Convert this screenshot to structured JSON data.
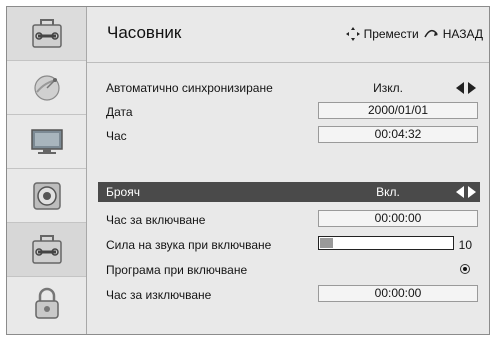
{
  "header": {
    "title": "Часовник",
    "move_hint": "Премести",
    "back_hint": "НАЗАД",
    "move_icon": "four-way-arrow-icon",
    "back_icon": "return-arrow-icon"
  },
  "sidebar": {
    "items": [
      {
        "icon": "toolbox-icon",
        "active": false
      },
      {
        "icon": "satellite-dish-icon",
        "active": false
      },
      {
        "icon": "monitor-icon",
        "active": false
      },
      {
        "icon": "speaker-icon",
        "active": false
      },
      {
        "icon": "toolbox-icon",
        "active": true
      },
      {
        "icon": "padlock-icon",
        "active": false
      }
    ]
  },
  "settings": {
    "auto_sync": {
      "label": "Автоматично синхронизиране",
      "value": "Изкл."
    },
    "date": {
      "label": "Дата",
      "value": "2000/01/01"
    },
    "time": {
      "label": "Час",
      "value": "00:04:32"
    },
    "timer": {
      "label": "Брояч",
      "value": "Вкл."
    },
    "on_time": {
      "label": "Час за включване",
      "value": "00:00:00"
    },
    "on_volume": {
      "label": "Сила на звука при включване",
      "value": "10",
      "level": 0.1
    },
    "on_program": {
      "label": "Програма при включване"
    },
    "off_time": {
      "label": "Час за изключване",
      "value": "00:00:00"
    }
  },
  "colors": {
    "panel": "#e9e9e9",
    "selected_row": "#4a4a4a",
    "active_sidebar": "#d7d7d7"
  }
}
